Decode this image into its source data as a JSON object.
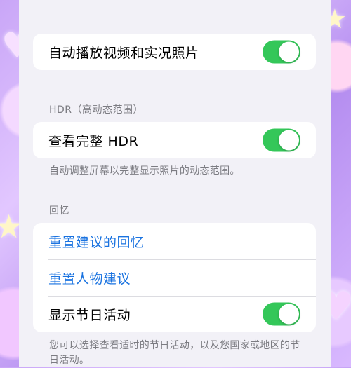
{
  "group1": {
    "rows": [
      {
        "label": "自动播放视频和实况照片",
        "toggle_on": true
      }
    ]
  },
  "hdr_section": {
    "header": "HDR（高动态范围）",
    "rows": [
      {
        "label": "查看完整 HDR",
        "toggle_on": true
      }
    ],
    "footer": "自动调整屏幕以完整显示照片的动态范围。"
  },
  "memories_section": {
    "header": "回忆",
    "rows": [
      {
        "label": "重置建议的回忆"
      },
      {
        "label": "重置人物建议"
      },
      {
        "label": "显示节日活动",
        "toggle_on": true
      }
    ],
    "footer": "您可以选择查看适时的节日活动，以及您国家或地区的节日活动。"
  },
  "colors": {
    "toggle_on": "#34c759",
    "link": "#1a73e0",
    "secondary_text": "#7c7c82"
  }
}
